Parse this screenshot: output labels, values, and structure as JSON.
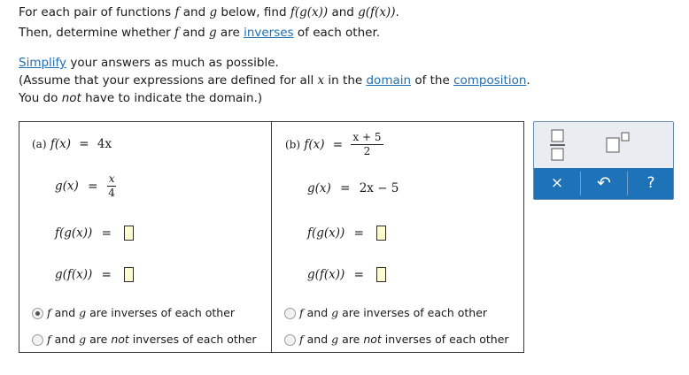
{
  "instructions": {
    "line1_a": "For each pair of functions ",
    "f": "f",
    "and": " and ",
    "g": "g",
    "line1_b": " below, find ",
    "fg_expr": "f(g(x))",
    "gf_expr": "g(f(x))",
    "period": ".",
    "line2_a": "Then, determine whether ",
    "line2_b": " are ",
    "inverses_link": "inverses",
    "line2_c": " of each other.",
    "simplify_link": "Simplify",
    "line3": " your answers as much as possible.",
    "line4_a": "(Assume that your expressions are defined for all ",
    "x": "x",
    "line4_b": " in the ",
    "domain_link": "domain",
    "line4_c": " of the ",
    "composition_link": "composition",
    "line5_a": "You do ",
    "not": "not",
    "line5_b": " have to indicate the domain.)"
  },
  "part_a": {
    "label": "(a)",
    "f_lhs": "f(x)",
    "eq": "=",
    "f_rhs": "4x",
    "g_lhs": "g(x)",
    "g_num": "x",
    "g_den": "4",
    "fg_lhs": "f(g(x))",
    "gf_lhs": "g(f(x))",
    "fg_answer": "",
    "gf_answer": "",
    "option1": "are inverses of each other",
    "option2_pre": "are ",
    "option2_not": "not",
    "option2_post": " inverses of each other",
    "selected": 1
  },
  "part_b": {
    "label": "(b)",
    "f_lhs": "f(x)",
    "eq": "=",
    "f_num": "x + 5",
    "f_den": "2",
    "g_lhs": "g(x)",
    "g_rhs": "2x − 5",
    "fg_lhs": "f(g(x))",
    "gf_lhs": "g(f(x))",
    "fg_answer": "",
    "gf_answer": "",
    "option1": "are inverses of each other",
    "option2_pre": "are ",
    "option2_not": "not",
    "option2_post": " inverses of each other",
    "selected": 0
  },
  "toolbox": {
    "fraction_icon": "fraction-template-icon",
    "superscript_icon": "superscript-template-icon",
    "clear_symbol": "×",
    "undo_symbol": "↶",
    "help_symbol": "?",
    "accent_color": "#1e73b8"
  }
}
